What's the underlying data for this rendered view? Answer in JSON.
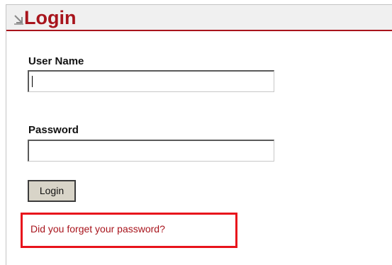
{
  "header": {
    "title": "Login",
    "icon": "arrow-down-right-icon",
    "accent_color": "#a8141c"
  },
  "form": {
    "username_label": "User Name",
    "username_value": "",
    "password_label": "Password",
    "password_value": "",
    "login_button_label": "Login",
    "forgot_link_text": "Did you forget your password?",
    "highlight_color": "#e8141c"
  }
}
